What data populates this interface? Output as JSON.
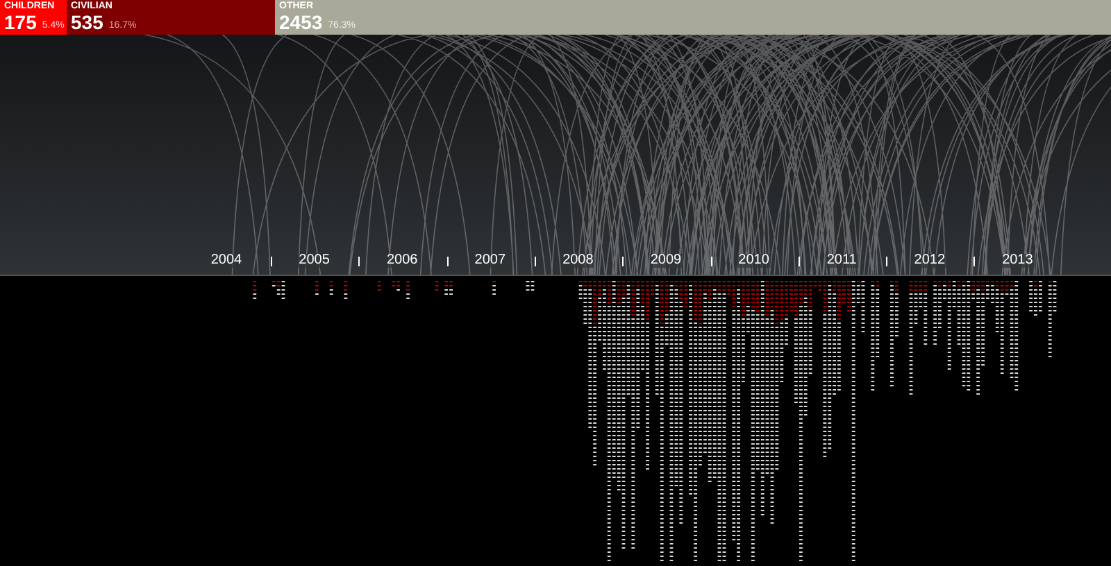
{
  "totals": [
    {
      "kind": "children",
      "label": "CHILDREN",
      "count": "175",
      "share": "5.4%"
    },
    {
      "kind": "civilian",
      "label": "CIVILIAN",
      "count": "535",
      "share": "16.7%"
    },
    {
      "kind": "other",
      "label": "OTHER",
      "count": "2453",
      "share": "76.3%"
    }
  ],
  "timeline": {
    "years": [
      "2004",
      "2005",
      "2006",
      "2007",
      "2008",
      "2009",
      "2010",
      "2011",
      "2012",
      "2013"
    ]
  }
}
